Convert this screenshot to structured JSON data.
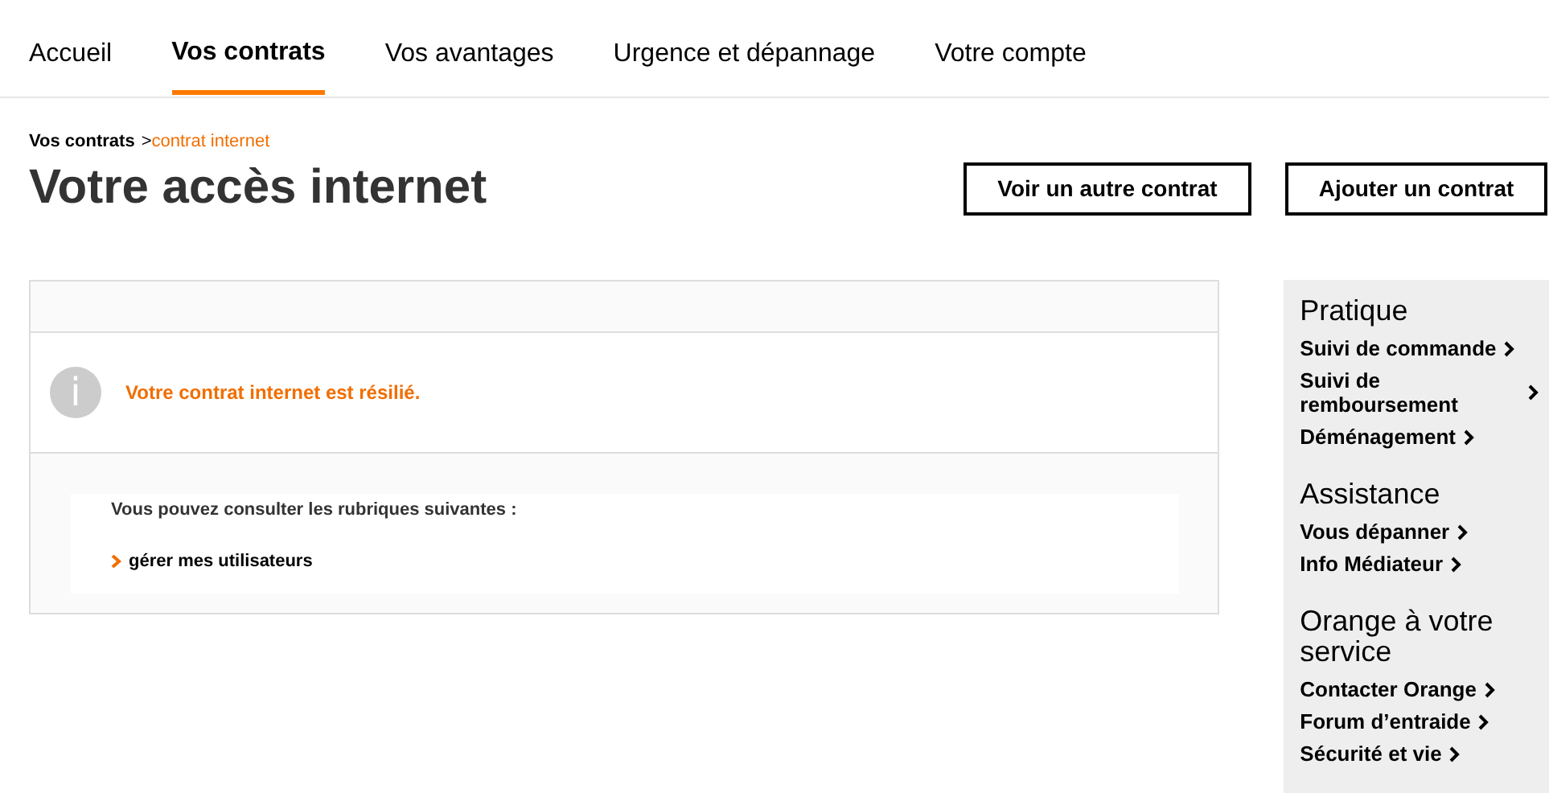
{
  "nav": [
    {
      "label": "Accueil",
      "selected": false
    },
    {
      "label": "Vos contrats",
      "selected": true
    },
    {
      "label": "Vos avantages",
      "selected": false
    },
    {
      "label": "Urgence et dépannage",
      "selected": false
    },
    {
      "label": "Votre compte",
      "selected": false
    }
  ],
  "breadcrumb": {
    "parent": "Vos contrats",
    "separator": ">",
    "current": "contrat internet"
  },
  "title": "Votre accès internet",
  "buttons": [
    "Voir un autre contrat",
    "Ajouter un contrat"
  ],
  "notice": {
    "icon": "i",
    "message": "Votre contrat internet est résilié."
  },
  "rubrics": {
    "intro": "Vous pouvez consulter les rubriques suivantes :",
    "links": [
      "gérer mes utilisateurs"
    ]
  },
  "sidebar": [
    {
      "title": "Pratique",
      "links": [
        "Suivi de commande",
        "Suivi de remboursement",
        "Déménagement"
      ]
    },
    {
      "title": "Assistance",
      "links": [
        "Vous dépanner",
        "Info Médiateur"
      ]
    },
    {
      "title": "Orange à votre service",
      "links": [
        "Contacter Orange",
        "Forum d’entraide",
        "Sécurité et vie"
      ]
    }
  ]
}
